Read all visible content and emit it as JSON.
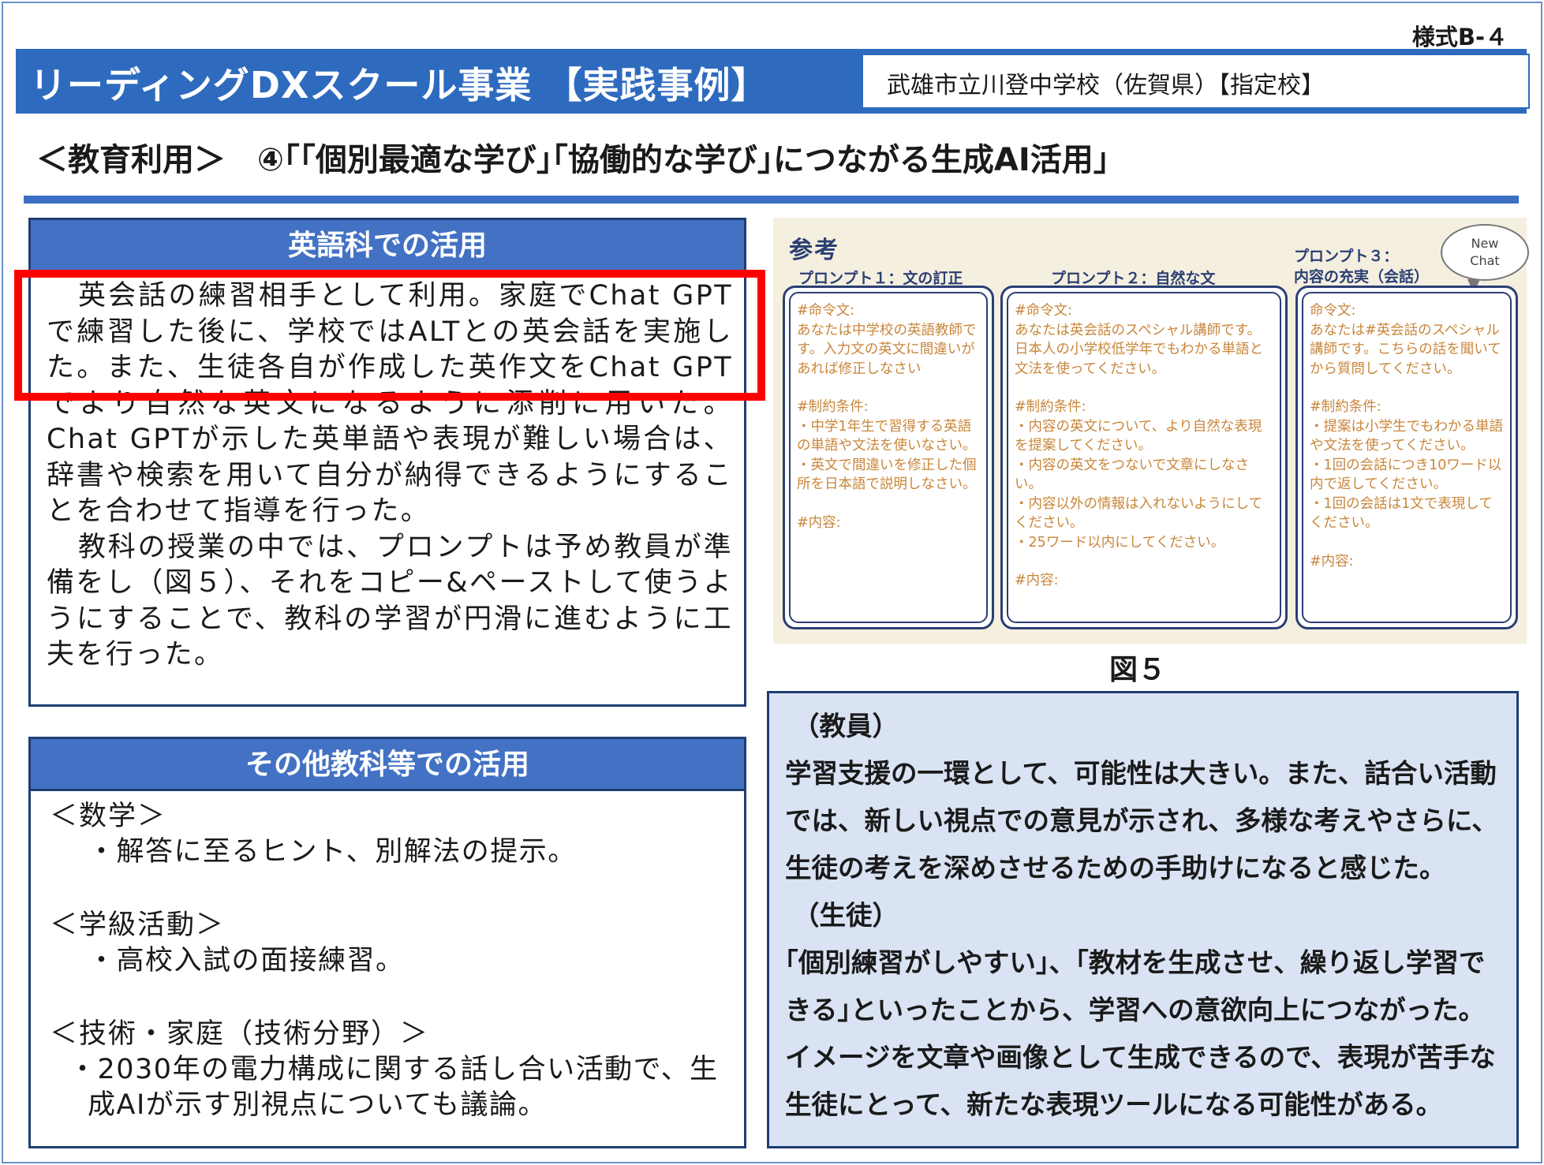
{
  "form_id": "様式B-４",
  "header": {
    "title": "リーディングDXスクール事業 【実践事例】",
    "school": "武雄市立川登中学校（佐賀県）【指定校】"
  },
  "subtitle": "＜教育利用＞　④｢｢個別最適な学び｣｢協働的な学び｣につながる生成AI活用｣",
  "english_panel": {
    "heading": "英語科での活用",
    "paragraphs": [
      "英会話の練習相手として利用。家庭でChat GPTで練習した後に、学校ではALTとの英会話を実施した。また、生徒各自が作成した英作文をChat GPTでより自然な英文になるように添削に用いた。Chat GPTが示した英単語や表現が難しい場合は、辞書や検索を用いて自分が納得できるようにすることを合わせて指導を行った。",
      "教科の授業の中では、プロンプトは予め教員が準備をし（図５）、それをコピー&ペーストして使うようにすることで、教科の学習が円滑に進むように工夫を行った。"
    ]
  },
  "other_panel": {
    "heading": "その他教科等での活用",
    "sections": [
      {
        "head": "＜数学＞",
        "items": [
          "・解答に至るヒント、別解法の提示。"
        ]
      },
      {
        "head": "＜学級活動＞",
        "items": [
          "・高校入試の面接練習。"
        ]
      },
      {
        "head": "＜技術・家庭（技術分野）＞",
        "items": [
          "・2030年の電力構成に関する話し合い活動で、生成AIが示す別視点についても議論。"
        ]
      }
    ]
  },
  "figure": {
    "sankou": "参考",
    "bubble_line1": "New",
    "bubble_line2": "Chat",
    "prompts": [
      {
        "label": "プロンプト１：文の訂正",
        "lines": [
          "#命令文:",
          "あなたは中学校の英語教師です。入力文の英文に間違いがあれば修正しなさい",
          "",
          "#制約条件:",
          "・中学1年生で習得する英語の単語や文法を使いなさい。",
          "・英文で間違いを修正した個所を日本語で説明しなさい。",
          "",
          "#内容:"
        ]
      },
      {
        "label": "プロンプト２：自然な文",
        "lines": [
          "#命令文:",
          "あなたは英会話のスペシャル講師です。日本人の小学校低学年でもわかる単語と文法を使ってください。",
          "",
          "#制約条件:",
          "・内容の英文について、より自然な表現を提案してください。",
          "・内容の英文をつないで文章にしなさい。",
          "・内容以外の情報は入れないようにしてください。",
          "・25ワード以内にしてください。",
          "",
          "#内容:"
        ]
      },
      {
        "label_line1": "プロンプト３：",
        "label_line2": "内容の充実（会話）",
        "lines": [
          "命令文:",
          "あなたは#英会話のスペシャル講師です。こちらの話を聞いてから質問してください。",
          "",
          "#制約条件:",
          "・提案は小学生でもわかる単語や文法を使ってください。",
          "・1回の会話につき10ワード以内で返してください。",
          "・1回の会話は1文で表現してください。",
          "",
          "#内容:"
        ]
      }
    ],
    "caption": "図５"
  },
  "comments": {
    "teacher_label": "（教員）",
    "teacher_text": "学習支援の一環として、可能性は大きい。また、話合い活動では、新しい視点での意見が示され、多様な考えやさらに、生徒の考えを深めさせるための手助けになると感じた。",
    "student_label": "（生徒）",
    "student_text": "｢個別練習がしやすい｣、｢教材を生成させ、繰り返し学習できる｣といったことから、学習への意欲向上につながった。イメージを文章や画像として生成できるので、表現が苦手な生徒にとって、新たな表現ツールになる可能性がある。"
  },
  "colors": {
    "title_bar": "#2e6bbf",
    "panel_head": "#4372c4",
    "highlight": "#ff0000",
    "comment_bg": "#dae3f3",
    "prompt_text": "#c9863a"
  }
}
